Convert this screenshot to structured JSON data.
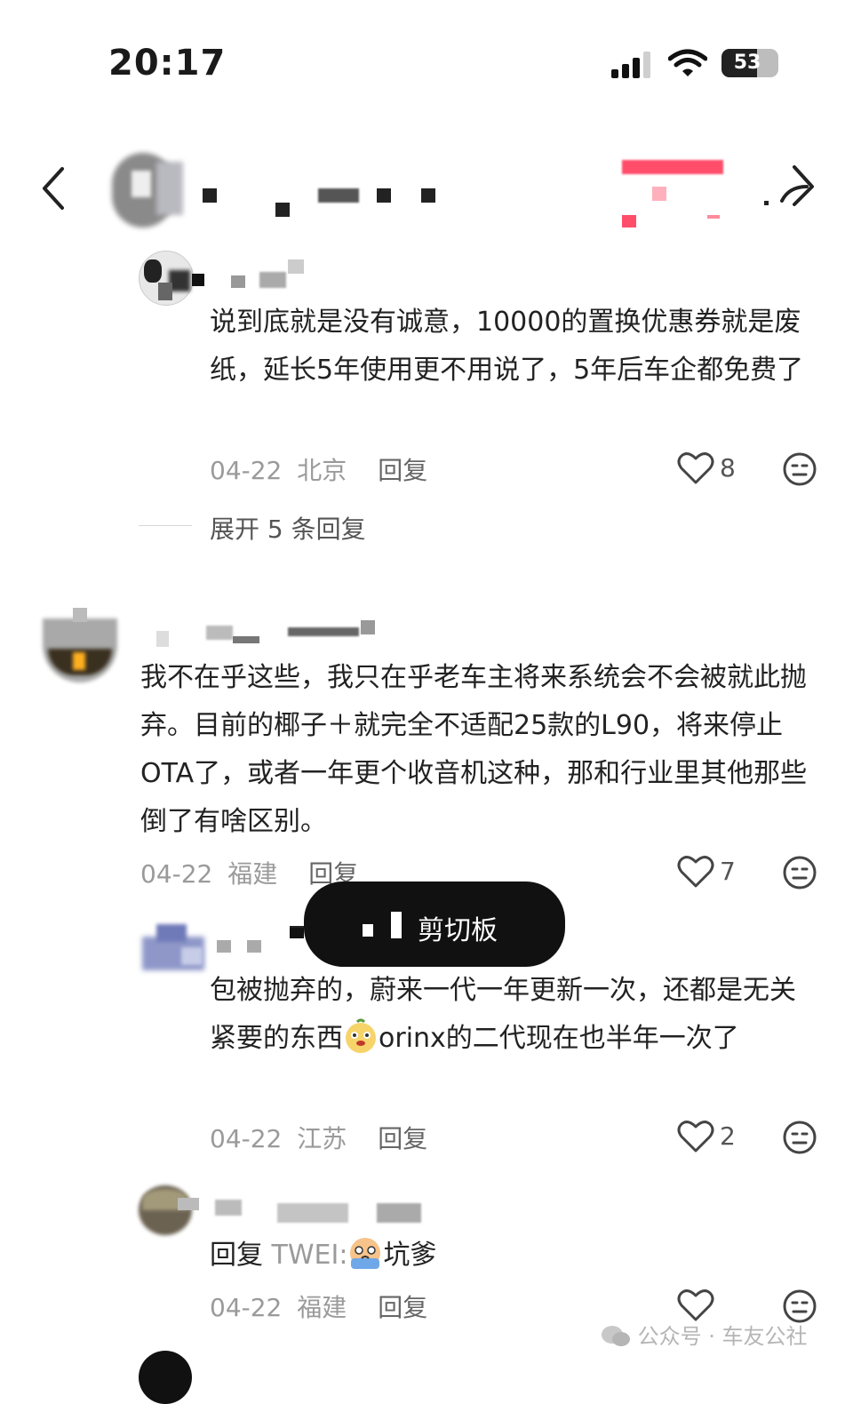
{
  "status_bar": {
    "time": "20:17",
    "battery": "53"
  },
  "comments": [
    {
      "id": "c1",
      "text": "说到底就是没有诚意，10000的置换优惠券就是废纸，延长5年使用更不用说了，5年后车企都免费了",
      "date": "04-22",
      "region": "北京",
      "reply_label": "回复",
      "likes": "8",
      "expand_label": "展开 5 条回复"
    },
    {
      "id": "c2",
      "text": "我不在乎这些，我只在乎老车主将来系统会不会被就此抛弃。目前的椰子＋就完全不适配25款的L90，将来停止OTA了，或者一年更个收音机这种，那和行业里其他那些倒了有啥区别。",
      "date": "04-22",
      "region": "福建",
      "reply_label": "回复",
      "likes": "7"
    },
    {
      "id": "c3",
      "text_a": "包被抛弃的，蔚来一代一年更新一次，还都是无关紧要的东西",
      "text_b": "orinx的二代现在也半年一次了",
      "date": "04-22",
      "region": "江苏",
      "reply_label": "回复",
      "likes": "2"
    },
    {
      "id": "c4",
      "reply_prefix": "回复",
      "reply_to": "TWEI:",
      "text": "坑爹",
      "date": "04-22",
      "region": "福建",
      "reply_label": "回复"
    }
  ],
  "toast": {
    "text": "剪切板"
  },
  "watermark": {
    "text": "公众号 · 车友公社"
  },
  "icons": {
    "back": "chevron-left-icon",
    "share": "share-arrow-icon",
    "like": "heart-outline-icon",
    "dislike": "neutral-face-icon"
  },
  "colors": {
    "text": "#222222",
    "meta": "#9a9a9a",
    "toast_bg": "#111111",
    "pink": "#ff4d6a"
  }
}
